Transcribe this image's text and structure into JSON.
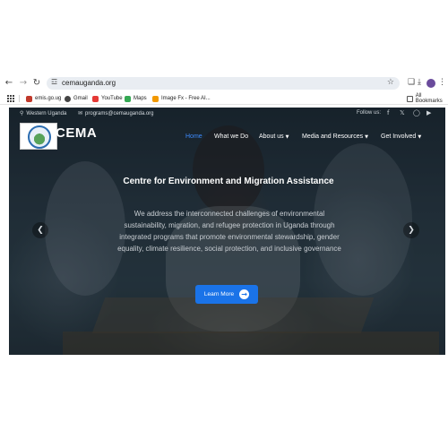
{
  "browser": {
    "url": "cemauganda.org",
    "bookmarks": [
      {
        "label": "emis.go.ug",
        "color": "#c0392b"
      },
      {
        "label": "Gmail",
        "color": "#444444"
      },
      {
        "label": "YouTube",
        "color": "#e53935"
      },
      {
        "label": "Maps",
        "color": "#34a853"
      },
      {
        "label": "Image Fx - Free AI...",
        "color": "#f29900"
      }
    ],
    "all_bookmarks": "All Bookmarks",
    "icons": {
      "back": "←",
      "forward": "→",
      "reload": "↻",
      "site_info": "☲",
      "star": "☆",
      "extensions": "❑",
      "download": "⤓",
      "menu": "⋮"
    }
  },
  "site": {
    "topbar": {
      "location": "Western Uganda",
      "email": "programs@cemauganda.org",
      "follow": "Follow us:",
      "social": [
        "f",
        "𝕏",
        "◯",
        "▶"
      ]
    },
    "logo_text": "CEMA",
    "menu": [
      {
        "label": "Home",
        "active": true,
        "dropdown": false
      },
      {
        "label": "What we Do",
        "active": false,
        "dropdown": false
      },
      {
        "label": "About us",
        "active": false,
        "dropdown": true
      },
      {
        "label": "Media and Resources",
        "active": false,
        "dropdown": true
      },
      {
        "label": "Get Involved",
        "active": false,
        "dropdown": true
      }
    ],
    "hero": {
      "title": "Centre for Environment and Migration Assistance",
      "text": "We address the interconnected challenges of environmental sustainability, migration, and refugee protection in Uganda through integrated programs that promote environmental stewardship, gender equality, climate resilience, social protection, and inclusive governance",
      "cta": "Learn More"
    },
    "colors": {
      "accent": "#1a73e8",
      "active_menu": "#3d8bfd"
    }
  }
}
